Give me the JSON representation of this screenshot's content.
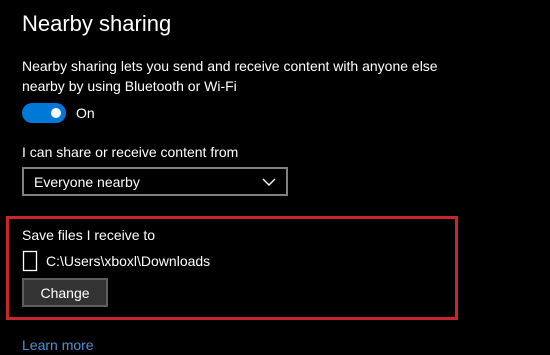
{
  "page": {
    "title": "Nearby sharing",
    "description": "Nearby sharing lets you send and receive content with anyone else nearby by using Bluetooth or Wi-Fi"
  },
  "toggle": {
    "state_label": "On",
    "is_on": true
  },
  "share_from": {
    "label": "I can share or receive content from",
    "selected": "Everyone nearby"
  },
  "save_location": {
    "label": "Save files I receive to",
    "path": "C:\\Users\\xboxl\\Downloads",
    "change_label": "Change"
  },
  "links": {
    "learn_more": "Learn more"
  },
  "icons": {
    "toggle": "toggle-switch",
    "dropdown": "chevron-down-icon",
    "folder_device": "device-icon"
  },
  "colors": {
    "background": "#000000",
    "accent": "#0078d7",
    "highlight_border": "#c8252c",
    "link": "#4a90d9",
    "button_bg": "#333333"
  }
}
